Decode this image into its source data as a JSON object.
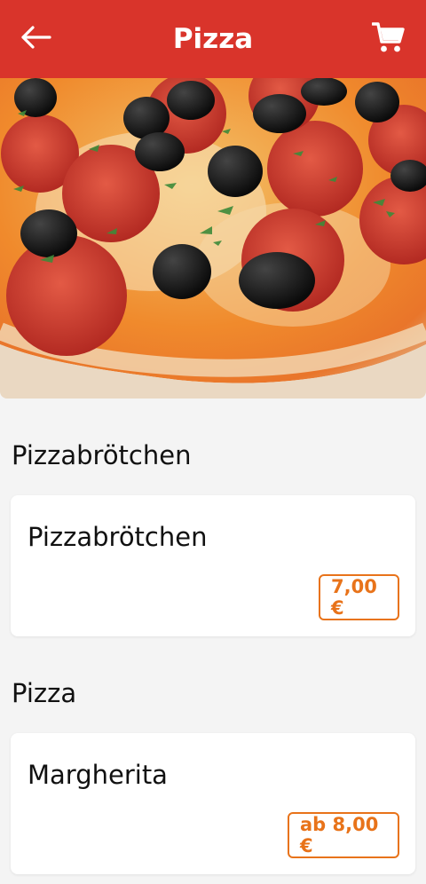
{
  "header": {
    "title": "Pizza",
    "back_icon": "arrow-left-icon",
    "cart_icon": "shopping-cart-icon",
    "accent_color": "#d9342b"
  },
  "hero": {
    "image": "pepperoni-olive-pizza-photo"
  },
  "sections": [
    {
      "title": "Pizzabrötchen",
      "items": [
        {
          "name": "Pizzabrötchen",
          "price": "7,00 €"
        }
      ]
    },
    {
      "title": "Pizza",
      "items": [
        {
          "name": "Margherita",
          "price": "ab 8,00 €"
        }
      ]
    }
  ],
  "price_color": "#e8731a"
}
